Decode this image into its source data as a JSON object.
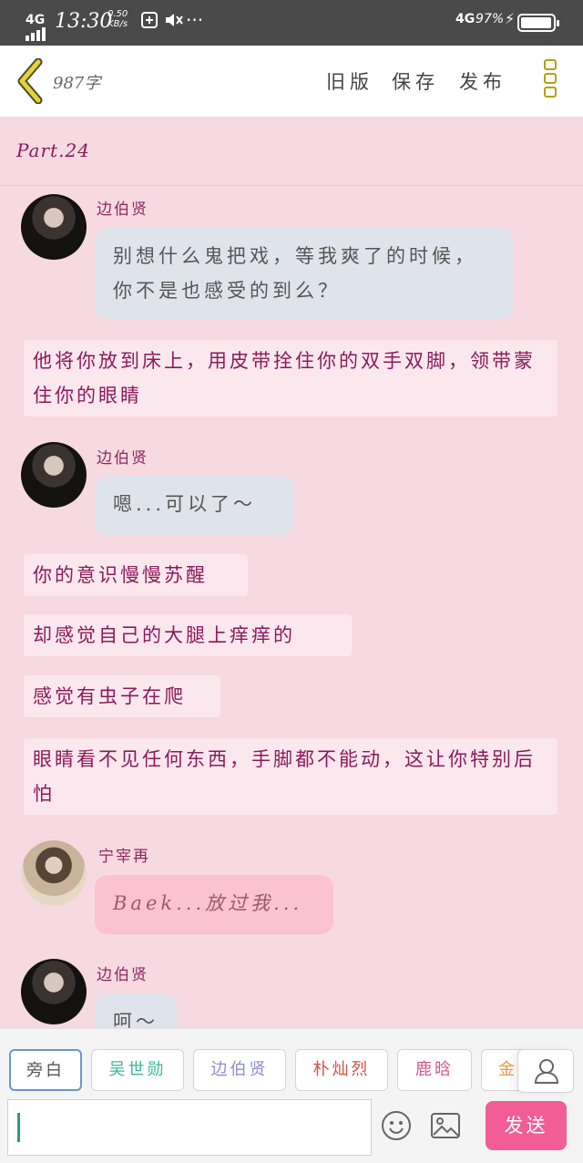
{
  "status_bar": {
    "network": "4G",
    "time": "13:30",
    "speed_value": "0.50",
    "speed_unit": "KB/s",
    "more": "···",
    "network_right": "4G",
    "battery": "97%",
    "battery_level": 0.97
  },
  "toolbar": {
    "word_count": "987字",
    "old_version": "旧版",
    "save": "保存",
    "publish": "发布"
  },
  "chapter": {
    "title": "Part.24"
  },
  "messages": [
    {
      "type": "character",
      "name": "边伯贤",
      "text": "别想什么鬼把戏，等我爽了的时候，你不是也感受的到么？"
    },
    {
      "type": "narration",
      "text": "他将你放到床上，用皮带拴住你的双手双脚，领带蒙住你的眼睛"
    },
    {
      "type": "character",
      "name": "边伯贤",
      "text": "嗯...可以了～"
    },
    {
      "type": "narration",
      "text": "你的意识慢慢苏醒"
    },
    {
      "type": "narration",
      "text": "却感觉自己的大腿上痒痒的"
    },
    {
      "type": "narration",
      "text": "感觉有虫子在爬"
    },
    {
      "type": "narration",
      "text": "眼睛看不见任何东西，手脚都不能动，这让你特别后怕"
    },
    {
      "type": "character",
      "name": "宁宰再",
      "text": "Baek...放过我..."
    },
    {
      "type": "character",
      "name": "边伯贤",
      "text": "呵～"
    }
  ],
  "roles": [
    {
      "label": "旁白",
      "color": "#555555"
    },
    {
      "label": "吴世勋",
      "color": "#3fb59a"
    },
    {
      "label": "边伯贤",
      "color": "#8e8ed0"
    },
    {
      "label": "朴灿烈",
      "color": "#d2524a"
    },
    {
      "label": "鹿晗",
      "color": "#d05a8c"
    },
    {
      "label": "金",
      "color": "#e49a4c"
    }
  ],
  "composer": {
    "send": "发送"
  },
  "colors": {
    "accent": "#f25d95",
    "narration": "#8b1a5a"
  },
  "icons": [
    "back-arrow-icon",
    "menu-icon",
    "person-icon",
    "smiley-icon",
    "image-icon"
  ]
}
